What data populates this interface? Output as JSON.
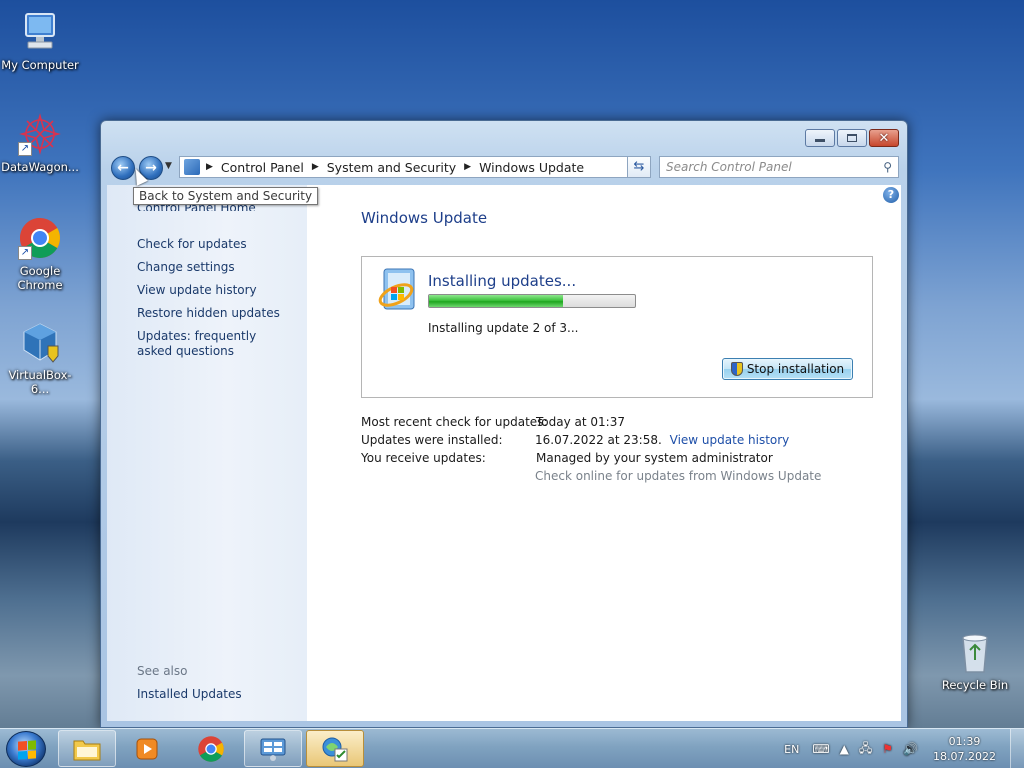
{
  "desktop": {
    "icons": [
      {
        "label": "My Computer",
        "icon": "computer-icon"
      },
      {
        "label": "DataWagon...",
        "icon": "datawagon-icon"
      },
      {
        "label": "Google Chrome",
        "icon": "chrome-icon"
      },
      {
        "label": "VirtualBox-6...",
        "icon": "virtualbox-icon"
      },
      {
        "label": "Recycle Bin",
        "icon": "recycle-bin-icon"
      }
    ]
  },
  "window": {
    "address": {
      "crumbs": [
        "Control Panel",
        "System and Security",
        "Windows Update"
      ]
    },
    "search_placeholder": "Search Control Panel",
    "tooltip": "Back to System and Security",
    "left": {
      "home_partial": "Control Panel Home",
      "links": [
        "Check for updates",
        "Change settings",
        "View update history",
        "Restore hidden updates",
        "Updates: frequently asked questions"
      ],
      "see_also": "See also",
      "installed_updates": "Installed Updates"
    },
    "main": {
      "title": "Windows Update",
      "status_title": "Installing updates...",
      "progress_fraction": 0.65,
      "status_sub": "Installing update 2 of 3...",
      "stop_button": "Stop installation",
      "info": {
        "recent_label": "Most recent check for updates:",
        "recent_value": "Today at 01:37",
        "installed_label": "Updates were installed:",
        "installed_value": "16.07.2022 at 23:58.",
        "installed_link": "View update history",
        "receive_label": "You receive updates:",
        "receive_value": "Managed by your system administrator",
        "online_check": "Check online for updates from Windows Update"
      }
    }
  },
  "taskbar": {
    "lang": "EN",
    "time": "01:39",
    "date": "18.07.2022"
  }
}
